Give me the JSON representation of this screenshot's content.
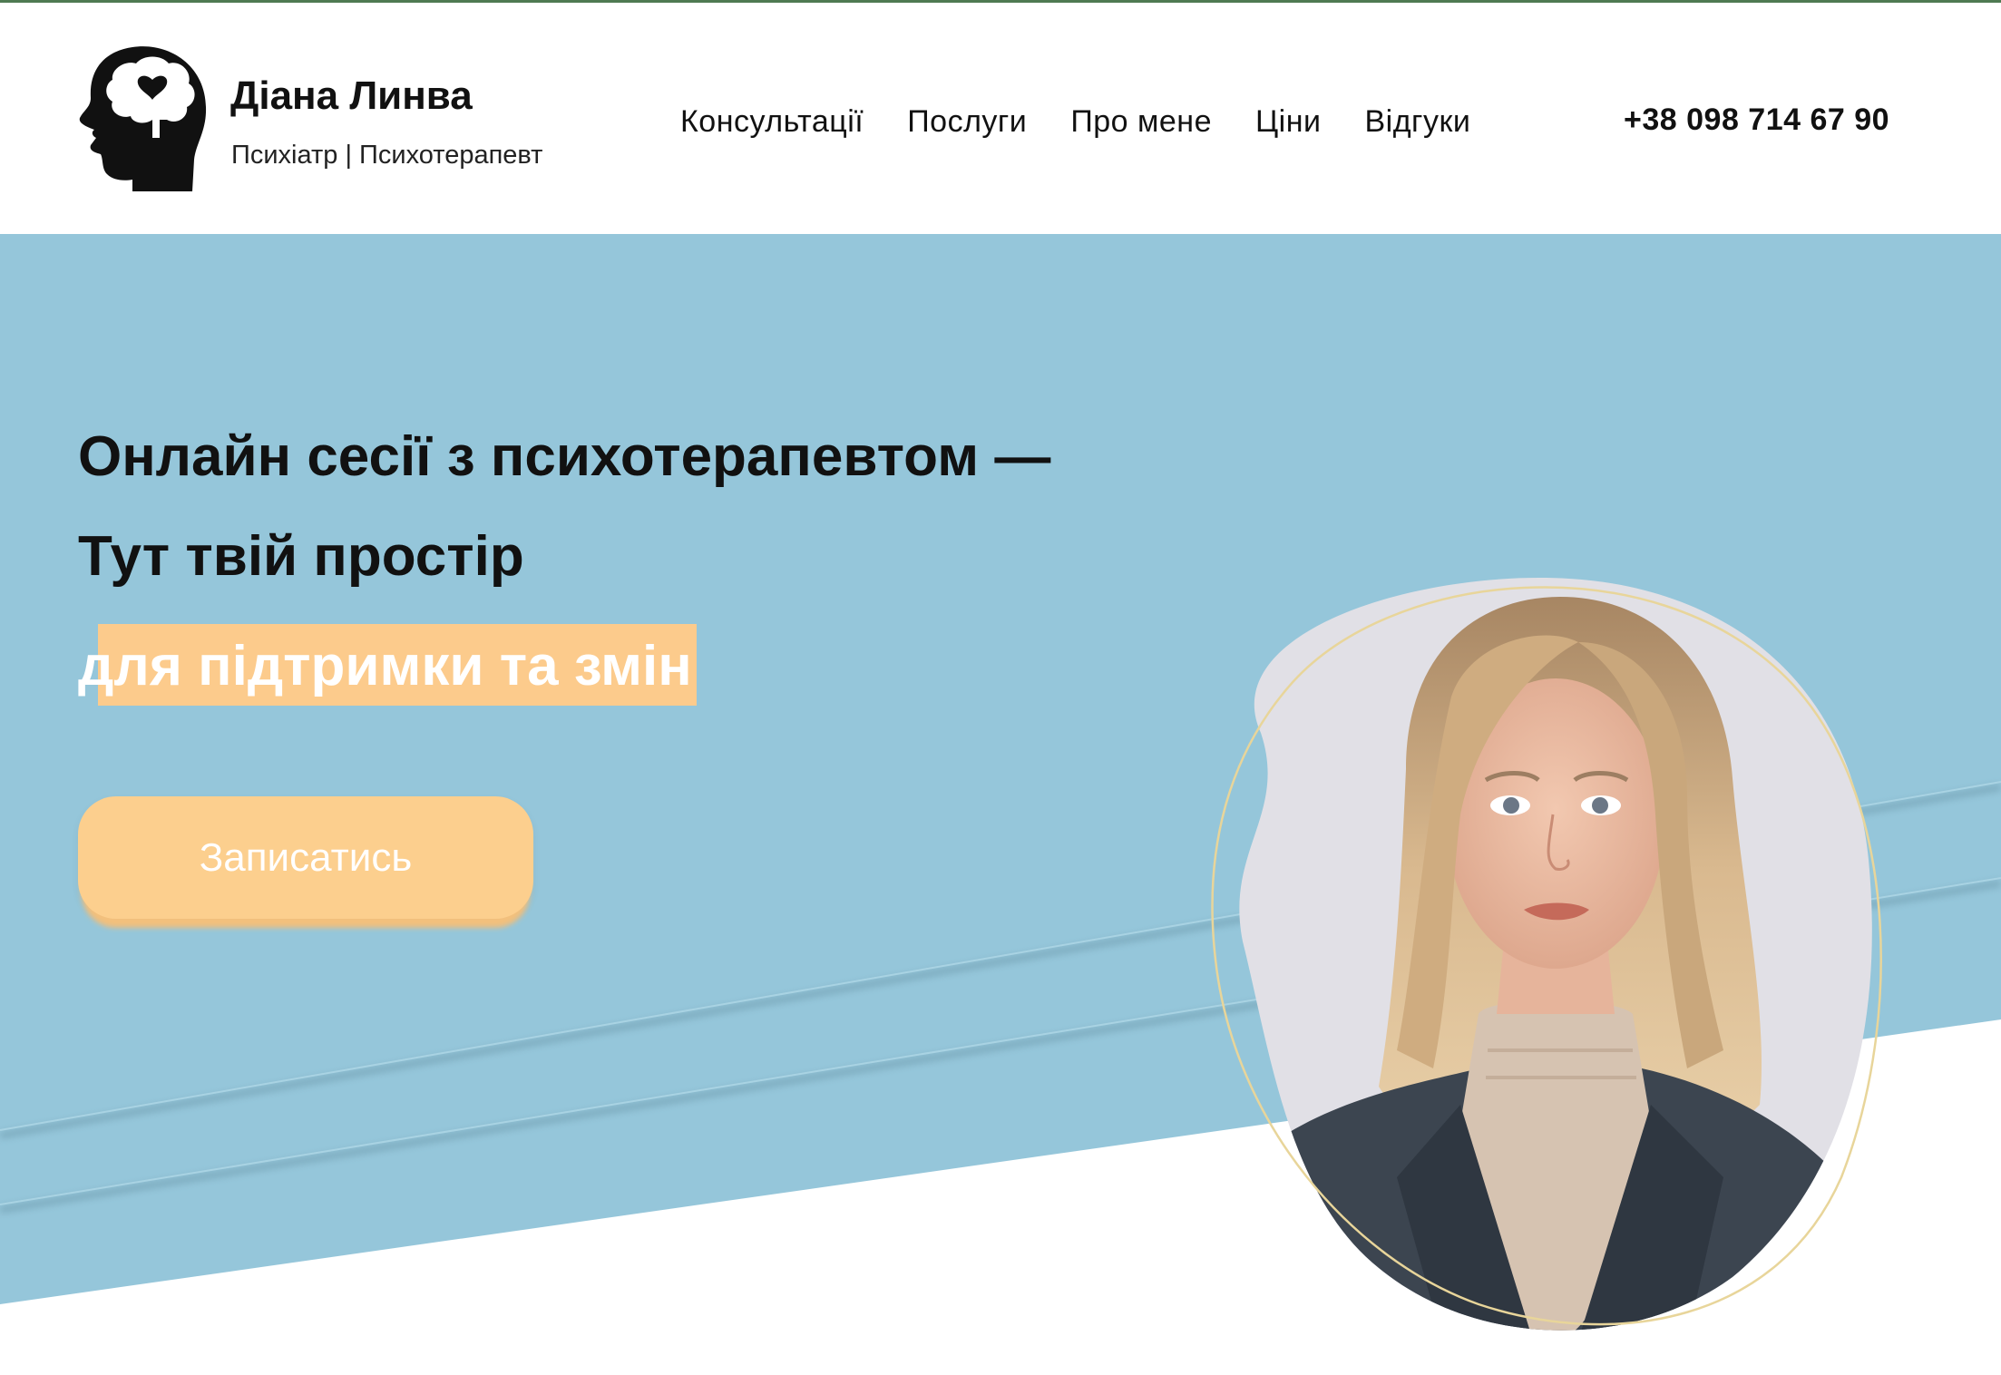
{
  "header": {
    "brand_name": "Діана Линва",
    "brand_subtitle": "Психіатр | Психотерапевт",
    "logo_icon": "head-brain-heart-icon",
    "nav": [
      {
        "label": "Консультації"
      },
      {
        "label": "Послуги"
      },
      {
        "label": "Про мене"
      },
      {
        "label": "Ціни"
      },
      {
        "label": "Відгуки"
      }
    ],
    "phone": "+38 098 714 67 90"
  },
  "hero": {
    "title_line1": "Онлайн сесії з психотерапевтом —",
    "title_line2": "Тут твій простір",
    "title_highlight": "для підтримки та змін",
    "cta_label": "Записатись",
    "portrait_alt": "portrait-photo"
  },
  "colors": {
    "hero_blue": "#95c6da",
    "accent_peach": "#fccf8e",
    "text_dark": "#111111",
    "ring_gold": "#e8d59a"
  }
}
